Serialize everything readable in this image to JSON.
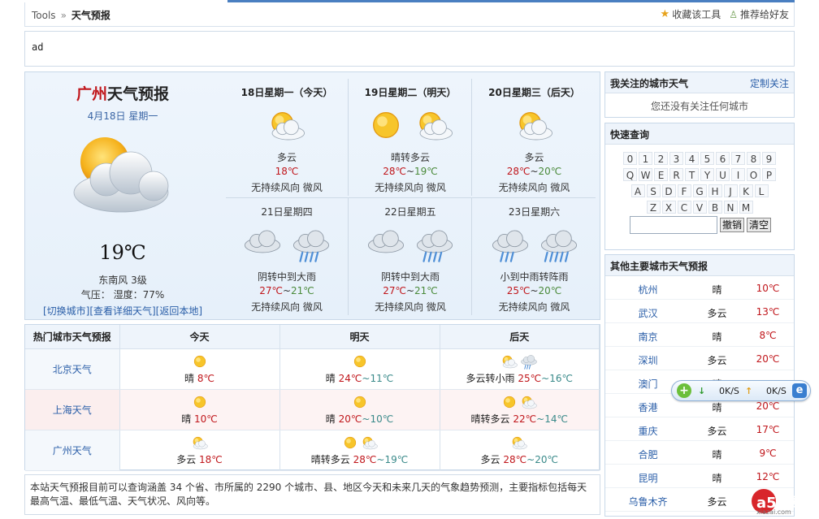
{
  "breadcrumb": {
    "root": "Tools",
    "sep": "»",
    "current": "天气预报"
  },
  "top_actions": {
    "fav": "收藏该工具",
    "share": "推荐给好友"
  },
  "ad": {
    "text": "ad"
  },
  "today": {
    "city": "广州",
    "title_suffix": "天气预报",
    "date": "4月18日 星期一",
    "temp": "19℃",
    "wind": "东南风 3级",
    "pressure_humidity": "气压： 湿度：77%",
    "links": "[切换城市][查看详细天气][返回本地]"
  },
  "forecast": [
    {
      "day": "18日星期一（今天）",
      "weather": "多云",
      "hi": "18℃",
      "lo": "",
      "wind": "无持续风向 微风",
      "icons": [
        "cloudy-sun"
      ]
    },
    {
      "day": "19日星期二（明天）",
      "weather": "晴转多云",
      "hi": "28℃",
      "lo": "19℃",
      "wind": "无持续风向 微风",
      "icons": [
        "sun",
        "cloudy-sun"
      ]
    },
    {
      "day": "20日星期三（后天）",
      "weather": "多云",
      "hi": "28℃",
      "lo": "20℃",
      "wind": "无持续风向 微风",
      "icons": [
        "cloudy-sun"
      ]
    },
    {
      "day": "21日星期四",
      "weather": "阴转中到大雨",
      "hi": "27℃",
      "lo": "21℃",
      "wind": "无持续风向 微风",
      "icons": [
        "overcast",
        "heavy-rain"
      ]
    },
    {
      "day": "22日星期五",
      "weather": "阴转中到大雨",
      "hi": "27℃",
      "lo": "21℃",
      "wind": "无持续风向 微风",
      "icons": [
        "overcast",
        "heavy-rain"
      ]
    },
    {
      "day": "23日星期六",
      "weather": "小到中雨转阵雨",
      "hi": "25℃",
      "lo": "20℃",
      "wind": "无持续风向 微风",
      "icons": [
        "light-rain",
        "shower"
      ]
    }
  ],
  "tilde": "~",
  "hot": {
    "headers": [
      "热门城市天气预报",
      "今天",
      "明天",
      "后天"
    ],
    "rows": [
      {
        "city": "北京天气",
        "today": {
          "w": "晴",
          "hi": "8℃",
          "lo": "",
          "icons": [
            "sun"
          ]
        },
        "tomorrow": {
          "w": "晴",
          "hi": "24℃",
          "lo": "11℃",
          "icons": [
            "sun"
          ]
        },
        "after": {
          "w": "多云转小雨",
          "hi": "25℃",
          "lo": "16℃",
          "icons": [
            "cloudy-sun",
            "light-rain"
          ]
        }
      },
      {
        "city": "上海天气",
        "today": {
          "w": "晴",
          "hi": "10℃",
          "lo": "",
          "icons": [
            "sun"
          ]
        },
        "tomorrow": {
          "w": "晴",
          "hi": "20℃",
          "lo": "10℃",
          "icons": [
            "sun"
          ]
        },
        "after": {
          "w": "晴转多云",
          "hi": "22℃",
          "lo": "14℃",
          "icons": [
            "sun",
            "cloudy-sun"
          ]
        }
      },
      {
        "city": "广州天气",
        "today": {
          "w": "多云",
          "hi": "18℃",
          "lo": "",
          "icons": [
            "cloudy-sun"
          ]
        },
        "tomorrow": {
          "w": "晴转多云",
          "hi": "28℃",
          "lo": "19℃",
          "icons": [
            "sun",
            "cloudy-sun"
          ]
        },
        "after": {
          "w": "多云",
          "hi": "28℃",
          "lo": "20℃",
          "icons": [
            "cloudy-sun"
          ]
        }
      }
    ]
  },
  "note": "本站天气预报目前可以查询涵盖 34 个省、市所属的 2290 个城市、县、地区今天和未来几天的气象趋势预测，主要指标包括每天最高气温、最低气温、天气状况、风向等。",
  "follow": {
    "title": "我关注的城市天气",
    "link": "定制关注",
    "empty": "您还没有关注任何城市"
  },
  "quick": {
    "title": "快速查询",
    "rows": [
      [
        "0",
        "1",
        "2",
        "3",
        "4",
        "5",
        "6",
        "7",
        "8",
        "9"
      ],
      [
        "Q",
        "W",
        "E",
        "R",
        "T",
        "Y",
        "U",
        "I",
        "O",
        "P"
      ],
      [
        "A",
        "S",
        "D",
        "F",
        "G",
        "H",
        "J",
        "K",
        "L"
      ],
      [
        "Z",
        "X",
        "C",
        "V",
        "B",
        "N",
        "M"
      ]
    ],
    "undo": "撤销",
    "clear": "清空"
  },
  "others": {
    "title": "其他主要城市天气预报",
    "rows": [
      {
        "city": "杭州",
        "w": "晴",
        "t": "10℃"
      },
      {
        "city": "武汉",
        "w": "多云",
        "t": "13℃"
      },
      {
        "city": "南京",
        "w": "晴",
        "t": "8℃"
      },
      {
        "city": "深圳",
        "w": "多云",
        "t": "20℃"
      },
      {
        "city": "澳门",
        "w": "晴",
        "t": ""
      },
      {
        "city": "香港",
        "w": "晴",
        "t": "20℃"
      },
      {
        "city": "重庆",
        "w": "多云",
        "t": "17℃"
      },
      {
        "city": "合肥",
        "w": "晴",
        "t": "9℃"
      },
      {
        "city": "昆明",
        "w": "晴",
        "t": "12℃"
      },
      {
        "city": "乌鲁木齐",
        "w": "多云",
        "t": ""
      }
    ]
  },
  "speed": {
    "down": "0K/S",
    "up": "0K/S"
  },
  "watermark": {
    "brand": "a5下载",
    "url": "xiazai.com"
  },
  "colors": {
    "accent": "#4a7fc1",
    "hot": "#c0161b",
    "link": "#2a5ea8"
  }
}
